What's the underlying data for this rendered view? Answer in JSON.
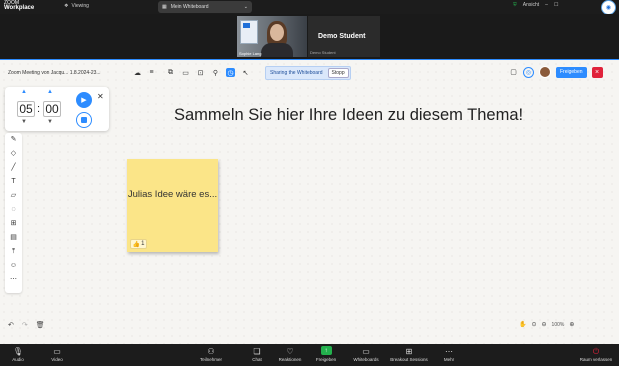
{
  "topbar": {
    "brand_line1": "ZOOM",
    "brand_line2": "Workplace",
    "viewing_label": "Viewing",
    "tab_label": "Mein Whiteboard",
    "status_label": "Ansicht"
  },
  "video": {
    "tile1_name": "Sophie Lang",
    "tile2_name": "Demo Student",
    "tile2_sub": "Demo Student"
  },
  "whiteboard": {
    "title": "Zoom Meeting von Jacqu... 1.8.2024-23...",
    "share_status": "Sharing the Whiteboard",
    "stop_label": "Stopp",
    "share_button": "Freigeben",
    "heading": "Sammeln Sie hier Ihre Ideen zu diesem Thema!",
    "timer": {
      "minutes": "05",
      "seconds": "00"
    },
    "sticky": {
      "text": "Julias Idee wäre es...",
      "reaction_emoji": "👍",
      "reaction_count": "1"
    },
    "zoom_level": "100%"
  },
  "bottom_bar": {
    "items": [
      {
        "label": "Audio",
        "icon": "mic-icon"
      },
      {
        "label": "Video",
        "icon": "video-icon"
      },
      {
        "label": "Teilnehmer",
        "icon": "participants-icon"
      },
      {
        "label": "Chat",
        "icon": "chat-icon"
      },
      {
        "label": "Reaktionen",
        "icon": "reactions-icon"
      },
      {
        "label": "Freigeben",
        "icon": "share-icon"
      },
      {
        "label": "Whiteboards",
        "icon": "whiteboard-icon"
      },
      {
        "label": "Breakout Sessions",
        "icon": "breakout-icon"
      },
      {
        "label": "Mehr",
        "icon": "more-icon"
      },
      {
        "label": "Raum verlassen",
        "icon": "leave-icon"
      }
    ]
  }
}
